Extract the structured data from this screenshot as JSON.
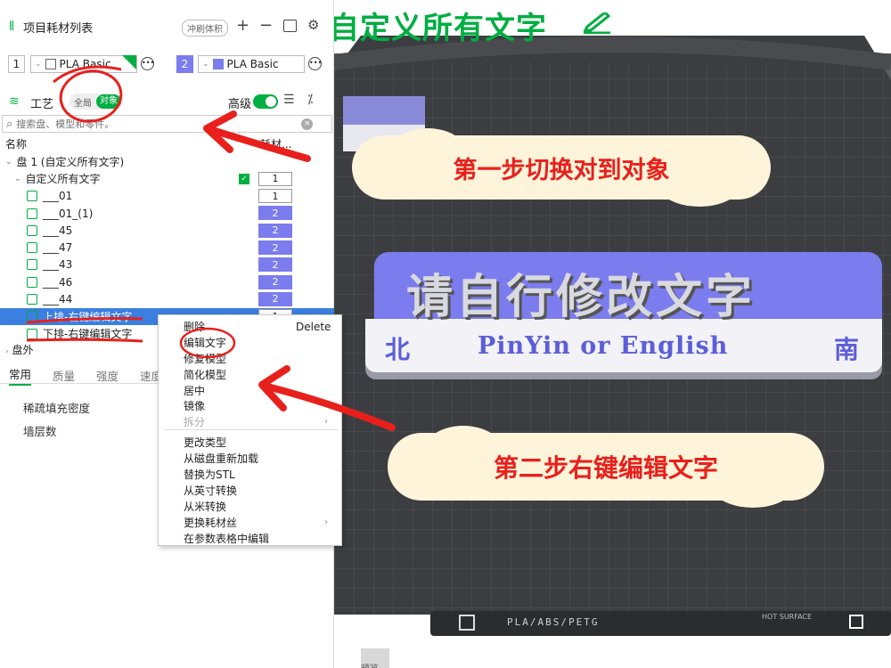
{
  "sidebar": {
    "title": "项目耗材列表",
    "flush_btn": "冲刷体积",
    "filaments": [
      {
        "index": "1",
        "name": "PLA Basic",
        "color": "#ffffff"
      },
      {
        "index": "2",
        "name": "PLA Basic",
        "color": "#7b7ced"
      }
    ],
    "process_label": "工艺",
    "scope_global": "全局",
    "scope_object": "对象",
    "advanced_label": "高级",
    "search_placeholder": "搜索盘、模型和零件。",
    "col_name": "名称",
    "col_filament": "耗材...",
    "tree": [
      {
        "label": "盘 1 (自定义所有文字)",
        "level": 0,
        "box": ""
      },
      {
        "label": "自定义所有文字",
        "level": 1,
        "box": "1",
        "style": "w"
      },
      {
        "label": "___01",
        "level": 2,
        "box": "1",
        "style": "w"
      },
      {
        "label": "___01_(1)",
        "level": 2,
        "box": "2",
        "style": "p"
      },
      {
        "label": "___45",
        "level": 2,
        "box": "2",
        "style": "p"
      },
      {
        "label": "___47",
        "level": 2,
        "box": "2",
        "style": "p"
      },
      {
        "label": "___43",
        "level": 2,
        "box": "2",
        "style": "p"
      },
      {
        "label": "___46",
        "level": 2,
        "box": "2",
        "style": "p"
      },
      {
        "label": "___44",
        "level": 2,
        "box": "2",
        "style": "p"
      },
      {
        "label": "上排-右键编辑文字",
        "level": 2,
        "box": "1",
        "style": "w",
        "selected": true
      },
      {
        "label": "下排-右键编辑文字",
        "level": 2,
        "box": "",
        "style": "w"
      }
    ],
    "outside_plate": "盘外",
    "tabs": [
      "常用",
      "质量",
      "强度",
      "速度"
    ],
    "props": [
      "稀疏填充密度",
      "墙层数"
    ]
  },
  "context_menu": {
    "items": [
      {
        "label": "删除",
        "shortcut": "Delete"
      },
      {
        "label": "编辑文字"
      },
      {
        "label": "修复模型"
      },
      {
        "label": "简化模型"
      },
      {
        "label": "居中"
      },
      {
        "label": "镜像",
        "submenu": true
      },
      {
        "label": "拆分",
        "disabled": true,
        "submenu": true
      },
      {
        "label": "更改类型"
      },
      {
        "label": "从磁盘重新加载"
      },
      {
        "label": "替换为STL"
      },
      {
        "label": "从英寸转换"
      },
      {
        "label": "从米转换"
      },
      {
        "label": "更换耗材丝",
        "submenu": true
      },
      {
        "label": "在参数表格中编辑"
      }
    ]
  },
  "viewport": {
    "top_title": "自定义所有文字",
    "sign_main": "请自行修改文字",
    "sign_left": "北",
    "sign_sub": "PinYin or English",
    "sign_right": "南",
    "plate_label": "PLA/ABS/PETG",
    "hot_label": "HOT SURFACE",
    "bottom_tab": "预览"
  },
  "annotations": {
    "step1": "第一步切换对到对象",
    "step2": "第二步右键编辑文字"
  },
  "colors": {
    "accent": "#00ae42",
    "filament2": "#7b7ced",
    "annotation_red": "#e8201c",
    "bed": "#3c3d40"
  }
}
